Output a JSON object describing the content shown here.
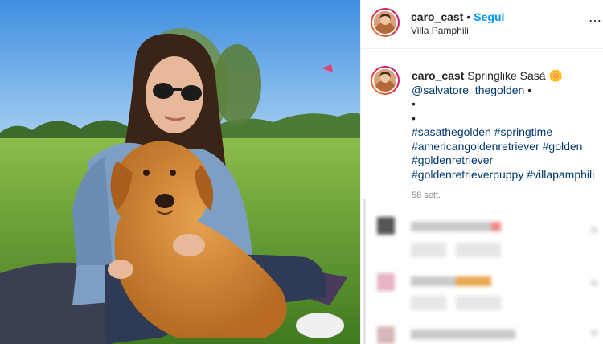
{
  "post": {
    "username": "caro_cast",
    "separator": "•",
    "follow_label": "Segui",
    "location": "Villa Pamphili",
    "more_icon": "more-options-icon"
  },
  "caption": {
    "username": "caro_cast",
    "text": "Springlike Sasà",
    "emoji": "🌼",
    "mention": "@salvatore_thegolden",
    "trailing_dot": "•",
    "dot_line_1": "•",
    "dot_line_2": "•",
    "hashtags_line_1": "#sasathegolden #springtime",
    "hashtags_line_2": "#americangoldenretriever #golden",
    "hashtags_line_3": "#goldenretriever",
    "hashtags_line_4": "#goldenretrieverpuppy #villapamphili"
  },
  "time_ago": "58 sett.",
  "colors": {
    "follow": "#0095f6",
    "hashtag": "#00376b",
    "secondary": "#8e8e8e",
    "story_ring_start": "#f09433",
    "story_ring_end": "#bc1888"
  }
}
